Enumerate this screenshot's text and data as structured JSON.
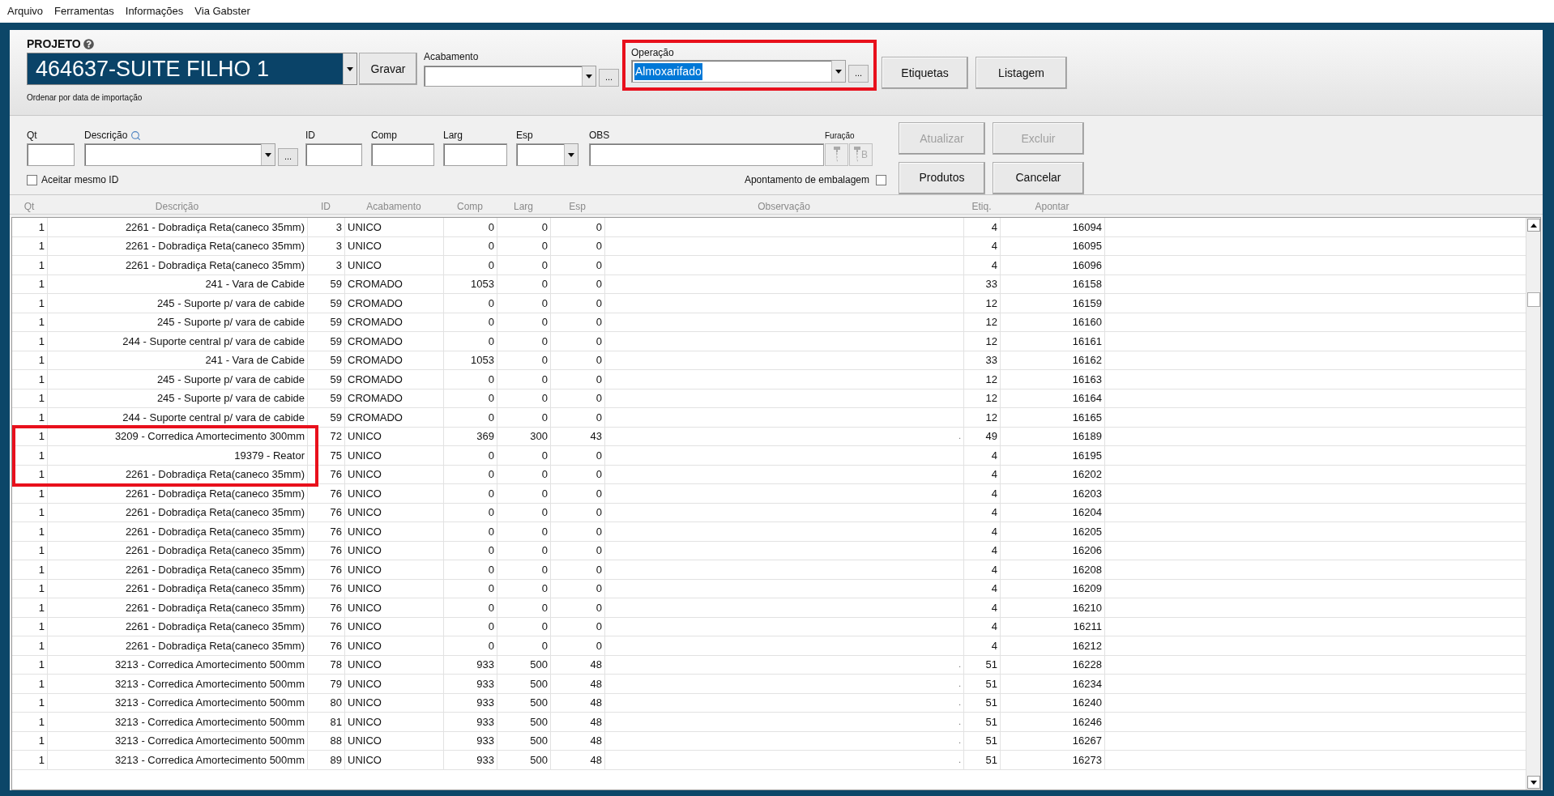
{
  "menu": [
    "Arquivo",
    "Ferramentas",
    "Informações",
    "Via Gabster"
  ],
  "header": {
    "project_label": "PROJETO",
    "project_value": "464637-SUITE FILHO 1",
    "save_button": "Gravar",
    "sort_note": "Ordenar por data de importação",
    "finish": {
      "label": "Acabamento",
      "ellipsis": "..."
    },
    "operation": {
      "label": "Operação",
      "value": "Almoxarifado",
      "value_selected": true,
      "ellipsis": "...",
      "annotated": true
    },
    "buttons": [
      {
        "label": "Etiquetas",
        "disabled": false
      },
      {
        "label": "Listagem",
        "disabled": false
      }
    ]
  },
  "entry": {
    "fields": [
      {
        "kind": "text",
        "label": "Qt"
      },
      {
        "kind": "combo_more",
        "label": "Descrição",
        "search": true,
        "ellipsis": "..."
      },
      {
        "kind": "text",
        "label": "ID"
      },
      {
        "kind": "text",
        "label": "Comp"
      },
      {
        "kind": "text",
        "label": "Larg"
      },
      {
        "kind": "combo",
        "label": "Esp"
      },
      {
        "kind": "text",
        "label": "OBS"
      }
    ],
    "drilling": {
      "label": "Furação",
      "disabled": true,
      "buttons": [
        {
          "kind": "drill"
        },
        {
          "kind": "drill",
          "mark": "B"
        }
      ]
    },
    "same_id": {
      "label": "Aceitar mesmo ID",
      "checked": false
    },
    "packing": {
      "label": "Apontamento de embalagem",
      "checked": false
    },
    "buttons": [
      {
        "label": "Atualizar",
        "disabled": true
      },
      {
        "label": "Excluir",
        "disabled": true
      },
      {
        "label": "Produtos",
        "disabled": false
      },
      {
        "label": "Cancelar",
        "disabled": false
      }
    ]
  },
  "table": {
    "columns": [
      "Qt",
      "Descrição",
      "ID",
      "Acabamento",
      "Comp",
      "Larg",
      "Esp",
      "Observação",
      "Etiq.",
      "Apontar"
    ],
    "rows": [
      {
        "qt": "1",
        "desc": "2261 - Dobradiça Reta(caneco 35mm)",
        "id": "3",
        "finish": "UNICO",
        "comp": "0",
        "larg": "0",
        "esp": "0",
        "etiq": "4",
        "apontar": "16094",
        "annotated": false
      },
      {
        "qt": "1",
        "desc": "2261 - Dobradiça Reta(caneco 35mm)",
        "id": "3",
        "finish": "UNICO",
        "comp": "0",
        "larg": "0",
        "esp": "0",
        "etiq": "4",
        "apontar": "16095",
        "annotated": false
      },
      {
        "qt": "1",
        "desc": "2261 - Dobradiça Reta(caneco 35mm)",
        "id": "3",
        "finish": "UNICO",
        "comp": "0",
        "larg": "0",
        "esp": "0",
        "etiq": "4",
        "apontar": "16096",
        "annotated": false
      },
      {
        "qt": "1",
        "desc": "241 - Vara de Cabide",
        "id": "59",
        "finish": "CROMADO",
        "comp": "1053",
        "larg": "0",
        "esp": "0",
        "etiq": "33",
        "apontar": "16158",
        "annotated": false
      },
      {
        "qt": "1",
        "desc": "245 - Suporte p/ vara de cabide",
        "id": "59",
        "finish": "CROMADO",
        "comp": "0",
        "larg": "0",
        "esp": "0",
        "etiq": "12",
        "apontar": "16159",
        "annotated": false
      },
      {
        "qt": "1",
        "desc": "245 - Suporte p/ vara de cabide",
        "id": "59",
        "finish": "CROMADO",
        "comp": "0",
        "larg": "0",
        "esp": "0",
        "etiq": "12",
        "apontar": "16160",
        "annotated": false
      },
      {
        "qt": "1",
        "desc": "244 - Suporte central p/ vara de cabide",
        "id": "59",
        "finish": "CROMADO",
        "comp": "0",
        "larg": "0",
        "esp": "0",
        "etiq": "12",
        "apontar": "16161",
        "annotated": false
      },
      {
        "qt": "1",
        "desc": "241 - Vara de Cabide",
        "id": "59",
        "finish": "CROMADO",
        "comp": "1053",
        "larg": "0",
        "esp": "0",
        "etiq": "33",
        "apontar": "16162",
        "annotated": false
      },
      {
        "qt": "1",
        "desc": "245 - Suporte p/ vara de cabide",
        "id": "59",
        "finish": "CROMADO",
        "comp": "0",
        "larg": "0",
        "esp": "0",
        "etiq": "12",
        "apontar": "16163",
        "annotated": false
      },
      {
        "qt": "1",
        "desc": "245 - Suporte p/ vara de cabide",
        "id": "59",
        "finish": "CROMADO",
        "comp": "0",
        "larg": "0",
        "esp": "0",
        "etiq": "12",
        "apontar": "16164",
        "annotated": false
      },
      {
        "qt": "1",
        "desc": "244 - Suporte central p/ vara de cabide",
        "id": "59",
        "finish": "CROMADO",
        "comp": "0",
        "larg": "0",
        "esp": "0",
        "etiq": "12",
        "apontar": "16165",
        "annotated": false
      },
      {
        "qt": "1",
        "desc": "3209 - Corredica Amortecimento 300mm",
        "id": "72",
        "finish": "UNICO",
        "comp": "369",
        "larg": "300",
        "esp": "43",
        "obs": ".",
        "etiq": "49",
        "apontar": "16189",
        "annotated": true
      },
      {
        "qt": "1",
        "desc": "19379 - Reator",
        "id": "75",
        "finish": "UNICO",
        "comp": "0",
        "larg": "0",
        "esp": "0",
        "etiq": "4",
        "apontar": "16195",
        "annotated": true
      },
      {
        "qt": "1",
        "desc": "2261 - Dobradiça Reta(caneco 35mm)",
        "id": "76",
        "finish": "UNICO",
        "comp": "0",
        "larg": "0",
        "esp": "0",
        "etiq": "4",
        "apontar": "16202",
        "annotated": true
      },
      {
        "qt": "1",
        "desc": "2261 - Dobradiça Reta(caneco 35mm)",
        "id": "76",
        "finish": "UNICO",
        "comp": "0",
        "larg": "0",
        "esp": "0",
        "etiq": "4",
        "apontar": "16203",
        "annotated": false
      },
      {
        "qt": "1",
        "desc": "2261 - Dobradiça Reta(caneco 35mm)",
        "id": "76",
        "finish": "UNICO",
        "comp": "0",
        "larg": "0",
        "esp": "0",
        "etiq": "4",
        "apontar": "16204",
        "annotated": false
      },
      {
        "qt": "1",
        "desc": "2261 - Dobradiça Reta(caneco 35mm)",
        "id": "76",
        "finish": "UNICO",
        "comp": "0",
        "larg": "0",
        "esp": "0",
        "etiq": "4",
        "apontar": "16205",
        "annotated": false
      },
      {
        "qt": "1",
        "desc": "2261 - Dobradiça Reta(caneco 35mm)",
        "id": "76",
        "finish": "UNICO",
        "comp": "0",
        "larg": "0",
        "esp": "0",
        "etiq": "4",
        "apontar": "16206",
        "annotated": false
      },
      {
        "qt": "1",
        "desc": "2261 - Dobradiça Reta(caneco 35mm)",
        "id": "76",
        "finish": "UNICO",
        "comp": "0",
        "larg": "0",
        "esp": "0",
        "etiq": "4",
        "apontar": "16208",
        "annotated": false
      },
      {
        "qt": "1",
        "desc": "2261 - Dobradiça Reta(caneco 35mm)",
        "id": "76",
        "finish": "UNICO",
        "comp": "0",
        "larg": "0",
        "esp": "0",
        "etiq": "4",
        "apontar": "16209",
        "annotated": false
      },
      {
        "qt": "1",
        "desc": "2261 - Dobradiça Reta(caneco 35mm)",
        "id": "76",
        "finish": "UNICO",
        "comp": "0",
        "larg": "0",
        "esp": "0",
        "etiq": "4",
        "apontar": "16210",
        "annotated": false
      },
      {
        "qt": "1",
        "desc": "2261 - Dobradiça Reta(caneco 35mm)",
        "id": "76",
        "finish": "UNICO",
        "comp": "0",
        "larg": "0",
        "esp": "0",
        "etiq": "4",
        "apontar": "16211",
        "annotated": false
      },
      {
        "qt": "1",
        "desc": "2261 - Dobradiça Reta(caneco 35mm)",
        "id": "76",
        "finish": "UNICO",
        "comp": "0",
        "larg": "0",
        "esp": "0",
        "etiq": "4",
        "apontar": "16212",
        "annotated": false
      },
      {
        "qt": "1",
        "desc": "3213 - Corredica Amortecimento 500mm",
        "id": "78",
        "finish": "UNICO",
        "comp": "933",
        "larg": "500",
        "esp": "48",
        "obs": ".",
        "etiq": "51",
        "apontar": "16228",
        "annotated": false
      },
      {
        "qt": "1",
        "desc": "3213 - Corredica Amortecimento 500mm",
        "id": "79",
        "finish": "UNICO",
        "comp": "933",
        "larg": "500",
        "esp": "48",
        "obs": ".",
        "etiq": "51",
        "apontar": "16234",
        "annotated": false
      },
      {
        "qt": "1",
        "desc": "3213 - Corredica Amortecimento 500mm",
        "id": "80",
        "finish": "UNICO",
        "comp": "933",
        "larg": "500",
        "esp": "48",
        "obs": ".",
        "etiq": "51",
        "apontar": "16240",
        "annotated": false
      },
      {
        "qt": "1",
        "desc": "3213 - Corredica Amortecimento 500mm",
        "id": "81",
        "finish": "UNICO",
        "comp": "933",
        "larg": "500",
        "esp": "48",
        "obs": ".",
        "etiq": "51",
        "apontar": "16246",
        "annotated": false
      },
      {
        "qt": "1",
        "desc": "3213 - Corredica Amortecimento 500mm",
        "id": "88",
        "finish": "UNICO",
        "comp": "933",
        "larg": "500",
        "esp": "48",
        "obs": ".",
        "etiq": "51",
        "apontar": "16267",
        "annotated": false
      },
      {
        "qt": "1",
        "desc": "3213 - Corredica Amortecimento 500mm",
        "id": "89",
        "finish": "UNICO",
        "comp": "933",
        "larg": "500",
        "esp": "48",
        "obs": ".",
        "etiq": "51",
        "apontar": "16273",
        "annotated": false
      }
    ]
  }
}
